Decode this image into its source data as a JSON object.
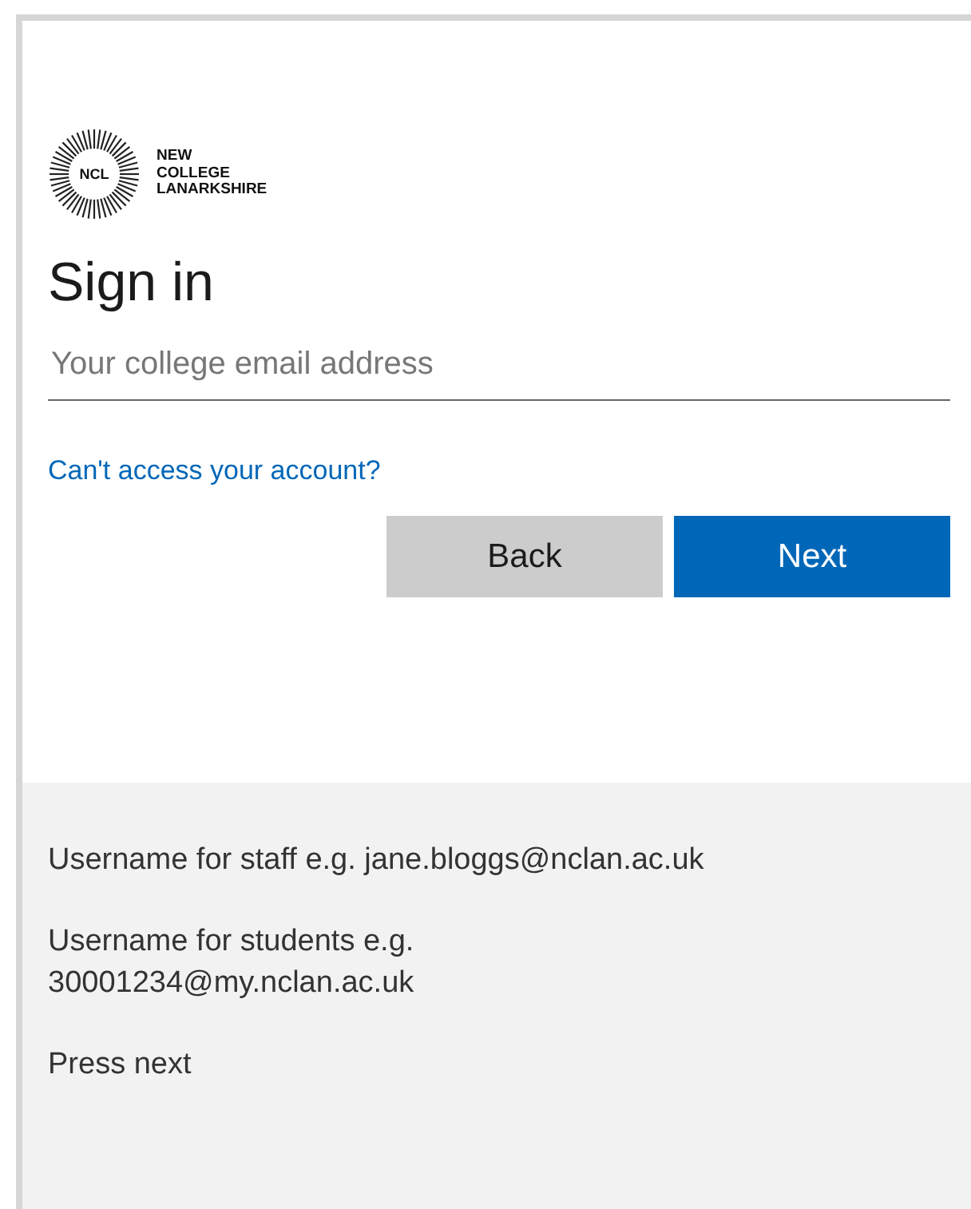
{
  "logo": {
    "initials": "NCL",
    "lines": [
      "NEW",
      "COLLEGE",
      "LANARKSHIRE"
    ]
  },
  "title": "Sign in",
  "email_field": {
    "placeholder": "Your college email address"
  },
  "link": "Can't access your account?",
  "buttons": [
    {
      "label": "Back",
      "kind": "secondary"
    },
    {
      "label": "Next",
      "kind": "primary"
    }
  ],
  "hints": [
    "Username for staff e.g. jane.bloggs@nclan.ac.uk",
    "Username for students e.g.\n30001234@my.nclan.ac.uk",
    "Press next"
  ]
}
